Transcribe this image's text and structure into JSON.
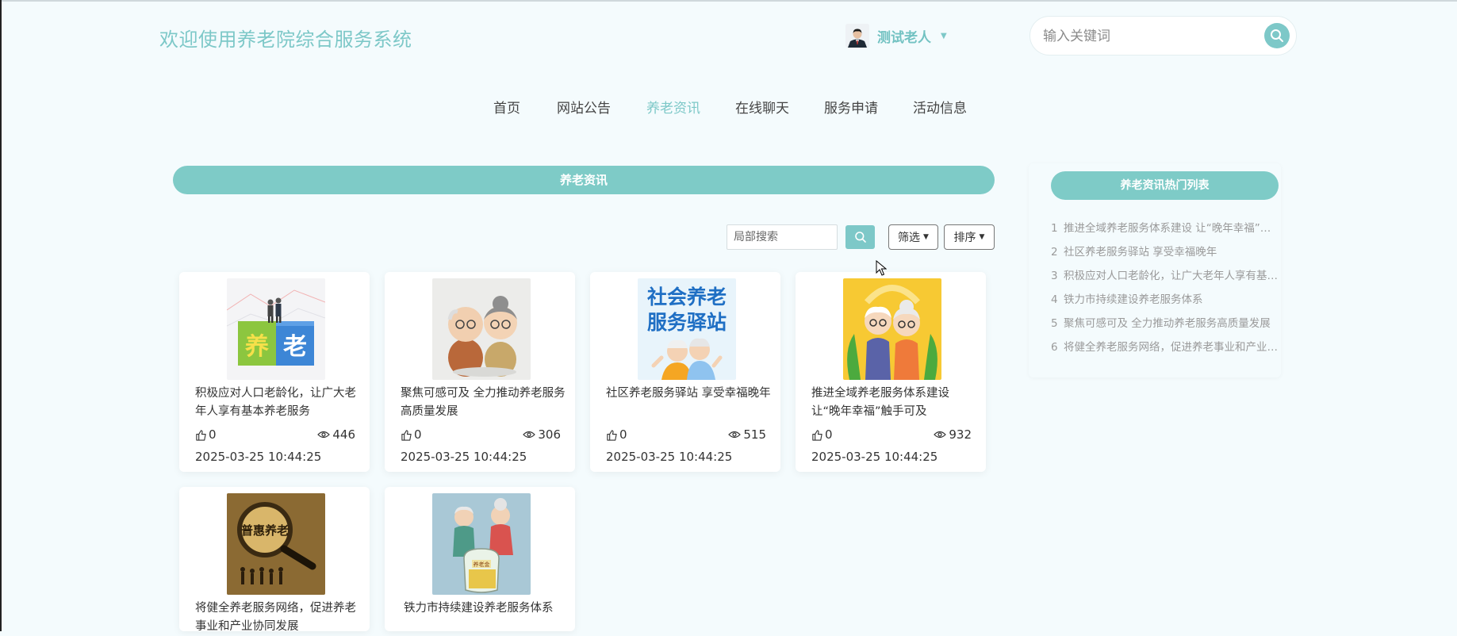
{
  "header": {
    "site_title": "欢迎使用养老院综合服务系统",
    "user_name": "测试老人",
    "search_placeholder": "输入关键词"
  },
  "nav": {
    "items": [
      {
        "label": "首页"
      },
      {
        "label": "网站公告"
      },
      {
        "label": "养老资讯"
      },
      {
        "label": "在线聊天"
      },
      {
        "label": "服务申请"
      },
      {
        "label": "活动信息"
      }
    ],
    "active": "养老资讯"
  },
  "main": {
    "section_title": "养老资讯",
    "local_search_placeholder": "局部搜索",
    "filter_label": "筛选",
    "sort_label": "排序",
    "cards": [
      {
        "title": "积极应对人口老龄化，让广大老年人享有基本养老服务",
        "likes": "0",
        "views": "446",
        "date": "2025-03-25 10:44:25",
        "image": "yang-lao-blocks"
      },
      {
        "title": "聚焦可感可及 全力推动养老服务高质量发展",
        "likes": "0",
        "views": "306",
        "date": "2025-03-25 10:44:25",
        "image": "elderly-couple-figurines"
      },
      {
        "title": "社区养老服务驿站 享受幸福晚年",
        "likes": "0",
        "views": "515",
        "date": "2025-03-25 10:44:25",
        "image": "community-station-poster"
      },
      {
        "title": "推进全域养老服务体系建设 让“晚年幸福”触手可及",
        "likes": "0",
        "views": "932",
        "date": "2025-03-25 10:44:25",
        "image": "elderly-couple-cartoon"
      },
      {
        "title": "将健全养老服务网络，促进养老事业和产业协同发展",
        "image": "magnifier-puhui"
      },
      {
        "title": "铁力市持续建设养老服务体系",
        "image": "elderly-coin-jar"
      }
    ]
  },
  "sidebar": {
    "title": "养老资讯热门列表",
    "items": [
      {
        "num": "1",
        "text": "推进全域养老服务体系建设 让“晚年幸福”触手可及"
      },
      {
        "num": "2",
        "text": "社区养老服务驿站 享受幸福晚年"
      },
      {
        "num": "3",
        "text": "积极应对人口老龄化，让广大老年人享有基本养老服务"
      },
      {
        "num": "4",
        "text": "铁力市持续建设养老服务体系"
      },
      {
        "num": "5",
        "text": "聚焦可感可及 全力推动养老服务高质量发展"
      },
      {
        "num": "6",
        "text": "将健全养老服务网络，促进养老事业和产业协同发展"
      }
    ]
  },
  "colors": {
    "accent": "#7dc8c8",
    "background": "#f4fbfd",
    "side_text": "#9a9a9a"
  },
  "card_image_text": {
    "c1_left": "养",
    "c1_right": "老",
    "c3_line1": "社会养老",
    "c3_line2": "服务驿站",
    "c5_label": "普惠养老",
    "c6_label": "养老金"
  }
}
